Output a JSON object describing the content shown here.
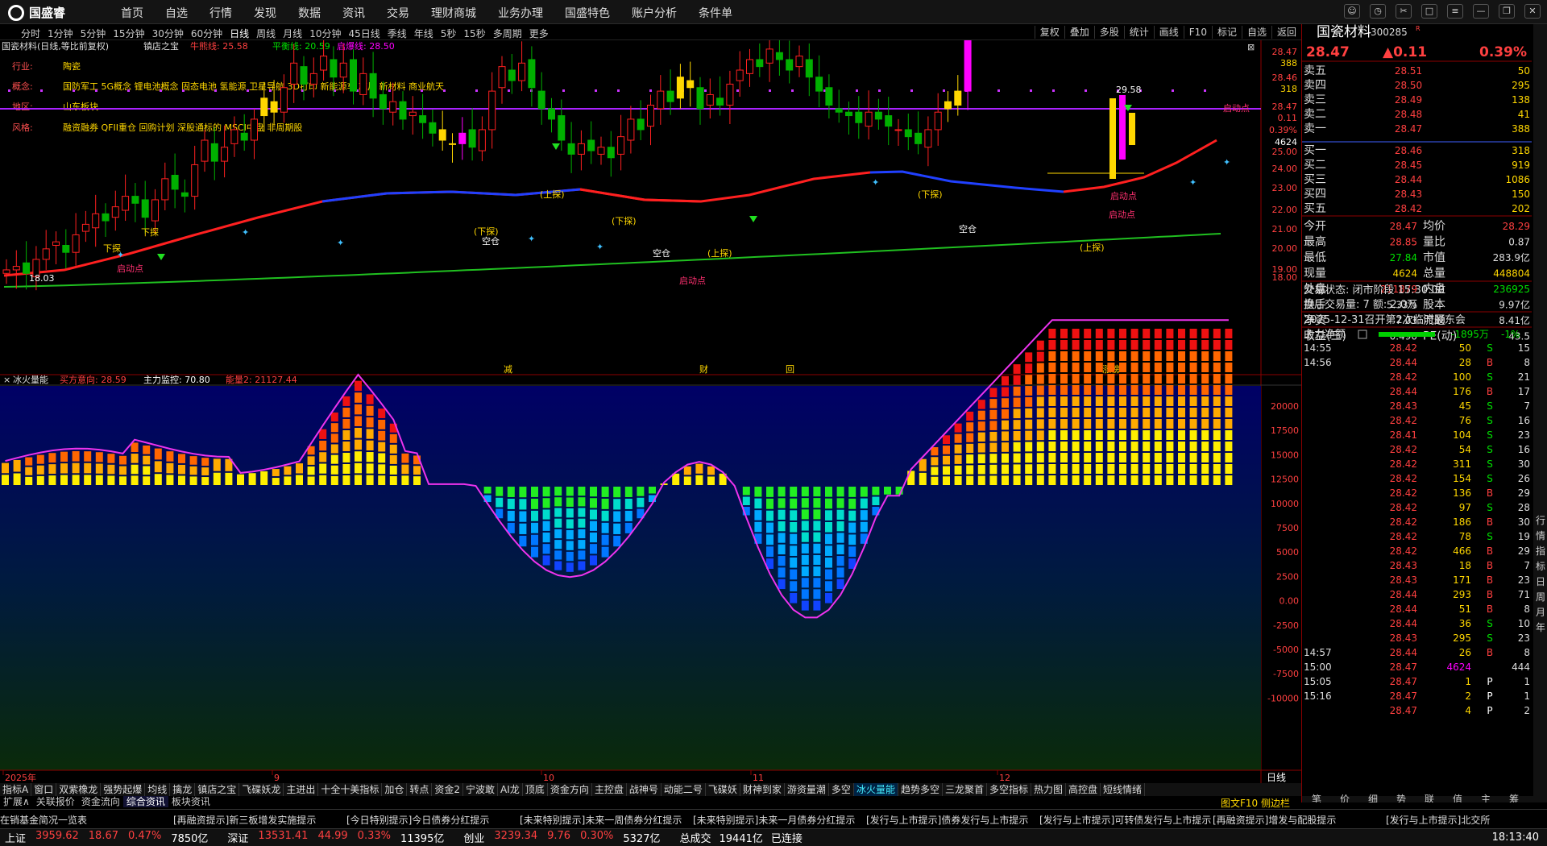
{
  "app": {
    "name": "国盛睿",
    "menus": [
      "首页",
      "自选",
      "行情",
      "发现",
      "数据",
      "资讯",
      "交易",
      "理财商城",
      "业务办理",
      "国盛特色",
      "账户分析",
      "条件单"
    ]
  },
  "periods": [
    "分时",
    "1分钟",
    "5分钟",
    "15分钟",
    "30分钟",
    "60分钟",
    "日线",
    "周线",
    "月线",
    "10分钟",
    "45日线",
    "季线",
    "年线",
    "5秒",
    "15秒",
    "多周期",
    "更多"
  ],
  "tools": [
    "复权",
    "叠加",
    "多股",
    "统计",
    "画线",
    "F10",
    "标记",
    "自选",
    "返回"
  ],
  "chart_header": {
    "title": "国瓷材料(日线,等比前复权)",
    "indicator": "镇店之宝",
    "l1": "牛熊线: 25.58",
    "l2": "平衡线: 20.59",
    "l3": "启爆线: 28.50"
  },
  "info": {
    "industry_label": "行业:",
    "industry": "陶瓷",
    "concept_label": "概念:",
    "concept": "国防军工 5G概念 锂电池概念 固态电池 氢能源 卫星导航 3D打印 新能源车 芯片 新材料 商业航天",
    "region_label": "地区:",
    "region": "山东板块",
    "style_label": "风格:",
    "style": "融资融券 QFII重仓 回购计划 深股通标的 MSCI中盘 非周期股"
  },
  "price_axis": [
    "28.47",
    "388",
    "28.46",
    "318",
    "28.47",
    "0.11",
    "0.39%",
    "4624",
    "25.00",
    "24.00",
    "23.00",
    "22.00",
    "21.00",
    "20.00",
    "19.00",
    "18.00"
  ],
  "annotations": {
    "high": "29.58",
    "low": "18.03",
    "launch": "启动点",
    "up": "(上探)",
    "down": "(下探)",
    "empty": "空仓",
    "xiatan": "下探"
  },
  "ind_header": {
    "title": "冰火量能",
    "a": "买方意向: 28.59",
    "b": "主力监控: 70.80",
    "c": "能量2: 21127.44"
  },
  "ind_axis": [
    "20000",
    "17500",
    "15000",
    "12500",
    "10000",
    "7500",
    "5000",
    "2500",
    "0.00",
    "-2500",
    "-5000",
    "-7500",
    "-10000"
  ],
  "date_axis": [
    "2025年",
    "9",
    "10",
    "11",
    "12"
  ],
  "period_label": "日线",
  "events": [
    "减",
    "财",
    "回",
    "涨榜"
  ],
  "indicator_tabs": [
    "指标A",
    "窗口",
    "双紫橡龙",
    "强势起爆",
    "均线",
    "擒龙",
    "镇店之宝",
    "飞碟妖龙",
    "主进出",
    "十全十美指标",
    "加仓",
    "转点",
    "资金2",
    "宁波敢",
    "AI龙",
    "顶底",
    "资金方向",
    "主控盘",
    "战神号",
    "动能二号",
    "飞碟妖",
    "财神到家",
    "游资量潮",
    "多空",
    "冰火量能",
    "趋势多空",
    "三龙聚首",
    "多空指标",
    "热力图",
    "高控盘",
    "短线情绪"
  ],
  "sub_tabs": [
    "扩展∧",
    "关联报价",
    "资金流向",
    "综合资讯",
    "板块资讯"
  ],
  "quote": {
    "name": "国瓷材料",
    "code": "300285",
    "price": "28.47",
    "change": "▲0.11",
    "pct": "0.39%",
    "asks": [
      [
        "卖五",
        "28.51",
        "50"
      ],
      [
        "卖四",
        "28.50",
        "295"
      ],
      [
        "卖三",
        "28.49",
        "138"
      ],
      [
        "卖二",
        "28.48",
        "41"
      ],
      [
        "卖一",
        "28.47",
        "388"
      ]
    ],
    "bids": [
      [
        "买一",
        "28.46",
        "318"
      ],
      [
        "买二",
        "28.45",
        "919"
      ],
      [
        "买三",
        "28.44",
        "1086"
      ],
      [
        "买四",
        "28.43",
        "150"
      ],
      [
        "买五",
        "28.42",
        "202"
      ]
    ],
    "stats": [
      [
        "今开",
        "28.47",
        "均价",
        "28.29"
      ],
      [
        "最高",
        "28.85",
        "量比",
        "0.87"
      ],
      [
        "最低",
        "27.84",
        "市值",
        "283.9亿"
      ],
      [
        "现量",
        "4624",
        "总量",
        "448804"
      ],
      [
        "外盘",
        "211879",
        "内盘",
        "236925"
      ],
      [
        "换手",
        "5.33%",
        "股本",
        "9.97亿"
      ],
      [
        "净资",
        "7.03",
        "流通",
        "8.41亿"
      ],
      [
        "收益(三)",
        "0.490",
        "PE(动)",
        "43.5"
      ]
    ],
    "trade_status": "交易状态: 闭市阶段 15:30:00",
    "after_hours": "盘后交易量: 7  额: 2.0万",
    "notice": "2025-12-31召开第2次临时股东会",
    "net_label": "主力净额",
    "net_value": "-1895万",
    "net_pct": "-1%",
    "ticks": [
      [
        "14:55",
        "28.42",
        "50",
        "S",
        "15"
      ],
      [
        "14:56",
        "28.44",
        "28",
        "B",
        "8"
      ],
      [
        "",
        "28.42",
        "100",
        "S",
        "21"
      ],
      [
        "",
        "28.44",
        "176",
        "B",
        "17"
      ],
      [
        "",
        "28.43",
        "45",
        "S",
        "7"
      ],
      [
        "",
        "28.42",
        "76",
        "S",
        "16"
      ],
      [
        "",
        "28.41",
        "104",
        "S",
        "23"
      ],
      [
        "",
        "28.42",
        "54",
        "S",
        "16"
      ],
      [
        "",
        "28.42",
        "311",
        "S",
        "30"
      ],
      [
        "",
        "28.42",
        "154",
        "S",
        "26"
      ],
      [
        "",
        "28.42",
        "136",
        "B",
        "29"
      ],
      [
        "",
        "28.42",
        "97",
        "S",
        "28"
      ],
      [
        "",
        "28.42",
        "186",
        "B",
        "30"
      ],
      [
        "",
        "28.42",
        "78",
        "S",
        "19"
      ],
      [
        "",
        "28.42",
        "466",
        "B",
        "29"
      ],
      [
        "",
        "28.43",
        "18",
        "B",
        "7"
      ],
      [
        "",
        "28.43",
        "171",
        "B",
        "23"
      ],
      [
        "",
        "28.44",
        "293",
        "B",
        "71"
      ],
      [
        "",
        "28.44",
        "51",
        "B",
        "8"
      ],
      [
        "",
        "28.44",
        "36",
        "S",
        "10"
      ],
      [
        "",
        "28.43",
        "295",
        "S",
        "23"
      ],
      [
        "14:57",
        "28.44",
        "26",
        "B",
        "8"
      ],
      [
        "15:00",
        "28.47",
        "4624",
        "",
        "444"
      ],
      [
        "15:05",
        "28.47",
        "1",
        "P",
        "1"
      ],
      [
        "15:16",
        "28.47",
        "2",
        "P",
        "1"
      ],
      [
        "",
        "28.47",
        "4",
        "P",
        "2"
      ]
    ],
    "side_tabs": [
      "行",
      "情",
      "指",
      "标",
      "日",
      "周",
      "月",
      "年"
    ],
    "bottom_tabs": [
      "笔",
      "价",
      "细",
      "势",
      "联",
      "值",
      "主",
      "筹"
    ]
  },
  "ticker_items": [
    "在销基金简况一览表",
    "[再融资提示]新三板增发实施提示",
    "[今日特别提示]今日债券分红提示",
    "[未来特别提示]未来一周债券分红提示",
    "[未来特别提示]未来一月债券分红提示",
    "[发行与上市提示]债券发行与上市提示",
    "[发行与上市提示]可转债发行与上市提示",
    "[再融资提示]增发与配股提示",
    "[发行与上市提示]北交所"
  ],
  "status_bar": [
    [
      "上证",
      "3959.62",
      "18.67",
      "0.47%",
      "7850亿"
    ],
    [
      "深证",
      "13531.41",
      "44.99",
      "0.33%",
      "11395亿"
    ],
    [
      "创业",
      "3239.34",
      "9.76",
      "0.30%",
      "5327亿"
    ]
  ],
  "status_extra": {
    "total": "总成交",
    "amount": "19441亿",
    "conn": "已连接",
    "time": "18:13:40",
    "f10": "图文F10",
    "side": "侧边栏"
  },
  "colors": {
    "up": "#ff3030",
    "down": "#00d000",
    "price": "#ff4040",
    "accent": "#ffd700"
  }
}
